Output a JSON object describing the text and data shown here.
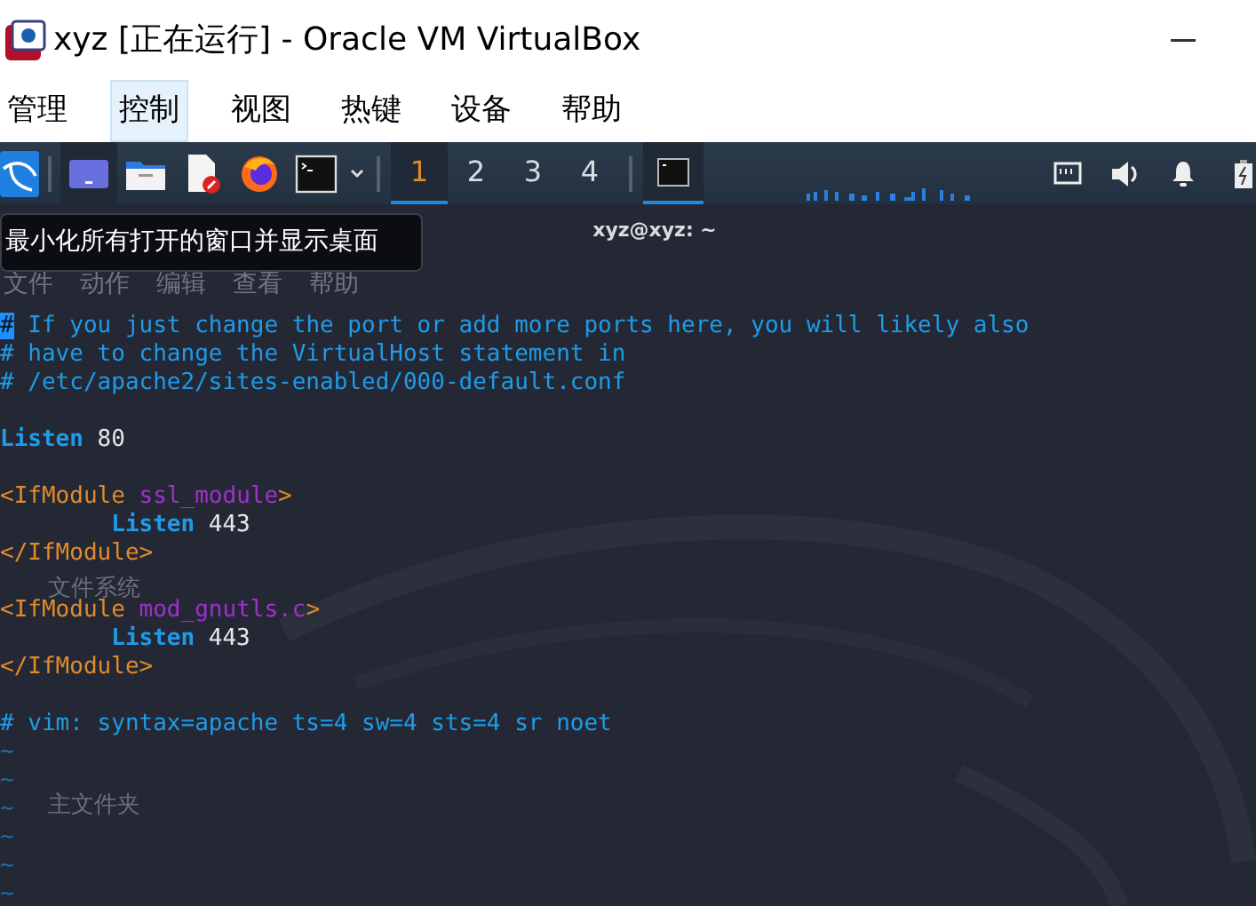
{
  "window": {
    "title": "xyz [正在运行] - Oracle VM VirtualBox"
  },
  "menubar": [
    {
      "label": "管理",
      "selected": false
    },
    {
      "label": "控制",
      "selected": true
    },
    {
      "label": "视图",
      "selected": false
    },
    {
      "label": "热键",
      "selected": false
    },
    {
      "label": "设备",
      "selected": false
    },
    {
      "label": "帮助",
      "selected": false
    }
  ],
  "panel": {
    "launchers": [
      {
        "kind": "desktop",
        "selected": true
      },
      {
        "kind": "files",
        "selected": false
      },
      {
        "kind": "editor",
        "selected": false
      },
      {
        "kind": "browser",
        "selected": false
      },
      {
        "kind": "terminal",
        "selected": false
      }
    ],
    "workspaces": [
      {
        "label": "1",
        "selected": true
      },
      {
        "label": "2",
        "selected": false
      },
      {
        "label": "3",
        "selected": false
      },
      {
        "label": "4",
        "selected": false
      }
    ],
    "tasks": [
      {
        "kind": "terminal",
        "selected": true
      }
    ]
  },
  "tooltip": "最小化所有打开的窗口并显示桌面",
  "terminal": {
    "title": "xyz@xyz: ~",
    "menu": [
      "文件",
      "动作",
      "编辑",
      "查看",
      "帮助"
    ],
    "lines": [
      {
        "kind": "code",
        "segments": [
          {
            "kind": "cursor",
            "text": "#"
          },
          {
            "kind": "comment",
            "text": " If you just change the port or add more ports here, you will likely also"
          }
        ]
      },
      {
        "kind": "code",
        "segments": [
          {
            "kind": "comment",
            "text": "# have to change the VirtualHost statement in"
          }
        ]
      },
      {
        "kind": "code",
        "segments": [
          {
            "kind": "comment",
            "text": "# /etc/apache2/sites-enabled/000-default.conf"
          }
        ]
      },
      {
        "kind": "blank"
      },
      {
        "kind": "code",
        "segments": [
          {
            "kind": "directive",
            "text": "Listen"
          },
          {
            "kind": "value",
            "text": " 80"
          }
        ]
      },
      {
        "kind": "blank"
      },
      {
        "kind": "code",
        "segments": [
          {
            "kind": "tag",
            "text": "<IfModule"
          },
          {
            "kind": "module",
            "text": " ssl_module"
          },
          {
            "kind": "tag",
            "text": ">"
          }
        ]
      },
      {
        "kind": "code",
        "segments": [
          {
            "kind": "directive",
            "text": "        Listen"
          },
          {
            "kind": "value",
            "text": " 443"
          }
        ]
      },
      {
        "kind": "code",
        "segments": [
          {
            "kind": "tag",
            "text": "</IfModule>"
          }
        ]
      },
      {
        "kind": "blank"
      },
      {
        "kind": "code",
        "segments": [
          {
            "kind": "tag",
            "text": "<IfModule"
          },
          {
            "kind": "module",
            "text": " mod_gnutls.c"
          },
          {
            "kind": "tag",
            "text": ">"
          }
        ]
      },
      {
        "kind": "code",
        "segments": [
          {
            "kind": "directive",
            "text": "        Listen"
          },
          {
            "kind": "value",
            "text": " 443"
          }
        ]
      },
      {
        "kind": "code",
        "segments": [
          {
            "kind": "tag",
            "text": "</IfModule>"
          }
        ]
      },
      {
        "kind": "blank"
      },
      {
        "kind": "code",
        "segments": [
          {
            "kind": "comment",
            "text": "# vim: syntax=apache ts=4 sw=4 sts=4 sr noet"
          }
        ]
      },
      {
        "kind": "code",
        "segments": [
          {
            "kind": "tilde",
            "text": "~"
          }
        ]
      },
      {
        "kind": "code",
        "segments": [
          {
            "kind": "tilde",
            "text": "~"
          }
        ]
      },
      {
        "kind": "code",
        "segments": [
          {
            "kind": "tilde",
            "text": "~"
          }
        ]
      },
      {
        "kind": "code",
        "segments": [
          {
            "kind": "tilde",
            "text": "~"
          }
        ]
      },
      {
        "kind": "code",
        "segments": [
          {
            "kind": "tilde",
            "text": "~"
          }
        ]
      },
      {
        "kind": "code",
        "segments": [
          {
            "kind": "tilde",
            "text": "~"
          }
        ]
      }
    ]
  },
  "desktop_labels": [
    "文件系统",
    "主文件夹"
  ]
}
